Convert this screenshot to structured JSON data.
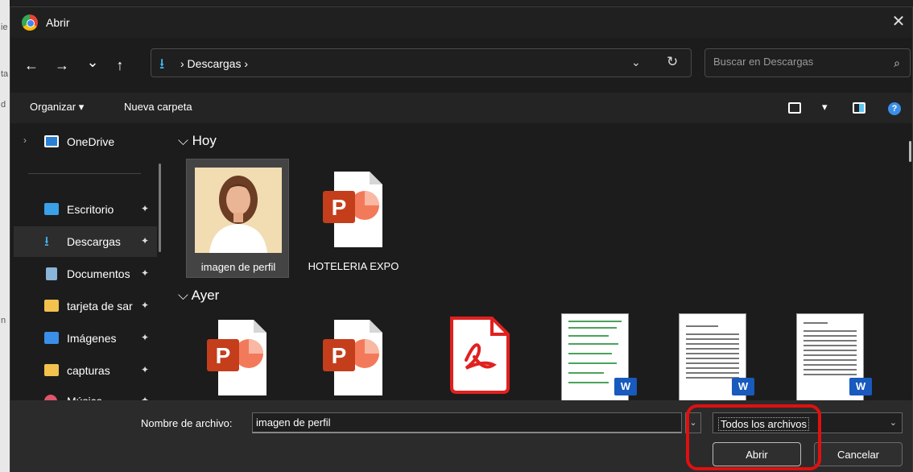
{
  "window": {
    "title": "Abrir",
    "close_glyph": "✕"
  },
  "nav": {
    "back_glyph": "←",
    "forward_glyph": "→",
    "recent_glyph": "⌄",
    "up_glyph": "↑",
    "address_icon": "download-icon",
    "breadcrumb": "› Descargas ›",
    "address_dropdown_glyph": "⌄",
    "refresh_glyph": "↻",
    "search_placeholder": "Buscar en Descargas",
    "search_glyph": "⌕"
  },
  "toolbar": {
    "organize_label": "Organizar ▾",
    "new_folder_label": "Nueva carpeta",
    "view_dropdown_glyph": "▾",
    "help_glyph": "?"
  },
  "sidebar": {
    "items": [
      {
        "label": "OneDrive",
        "icon": "onedrive-icon",
        "color": "#2b7fd4"
      },
      {
        "label": "Escritorio",
        "icon": "desktop-icon",
        "color": "#3aa0e8",
        "pin": "📌"
      },
      {
        "label": "Descargas",
        "icon": "download-icon",
        "color": "#44b7f0",
        "pin": "📌",
        "active": true
      },
      {
        "label": "Documentos",
        "icon": "documents-icon",
        "color": "#8ab4d8",
        "pin": "📌"
      },
      {
        "label": "tarjeta de sar",
        "icon": "folder-icon",
        "color": "#f2c14e",
        "pin": "📌"
      },
      {
        "label": "Imágenes",
        "icon": "pictures-icon",
        "color": "#3b8fe8",
        "pin": "📌"
      },
      {
        "label": "capturas",
        "icon": "folder-icon",
        "color": "#f2c14e",
        "pin": "📌"
      },
      {
        "label": "Música",
        "icon": "music-icon",
        "color": "#e0556a",
        "pin": "📌"
      }
    ],
    "expand_glyph": "›"
  },
  "content": {
    "groups": [
      {
        "title": "⌵ Hoy",
        "files": [
          {
            "name": "imagen de perfil",
            "icon": "image-thumbnail",
            "selected": true
          },
          {
            "name": "HOTELERIA EXPO",
            "icon": "powerpoint-icon"
          }
        ]
      },
      {
        "title": "⌵ Ayer",
        "files": [
          {
            "name": "",
            "icon": "powerpoint-icon"
          },
          {
            "name": "",
            "icon": "powerpoint-icon"
          },
          {
            "name": "",
            "icon": "pdf-icon",
            "badge": "PDF"
          },
          {
            "name": "",
            "icon": "word-document-icon"
          },
          {
            "name": "",
            "icon": "word-document-icon"
          },
          {
            "name": "",
            "icon": "word-document-icon"
          }
        ]
      }
    ],
    "ppt_letter": "P",
    "word_letter": "W"
  },
  "footer": {
    "filename_label": "Nombre de archivo:",
    "filename_value": "imagen de perfil",
    "filename_dropdown_glyph": "⌄",
    "filetype_value": "Todos los archivos",
    "filetype_dropdown_glyph": "⌄",
    "open_label": "Abrir",
    "cancel_label": "Cancelar"
  },
  "colors": {
    "accent_blue": "#44b7f0",
    "powerpoint": "#c43e1c",
    "pdf": "#e0211f",
    "word": "#185abd",
    "highlight": "#e01010"
  }
}
